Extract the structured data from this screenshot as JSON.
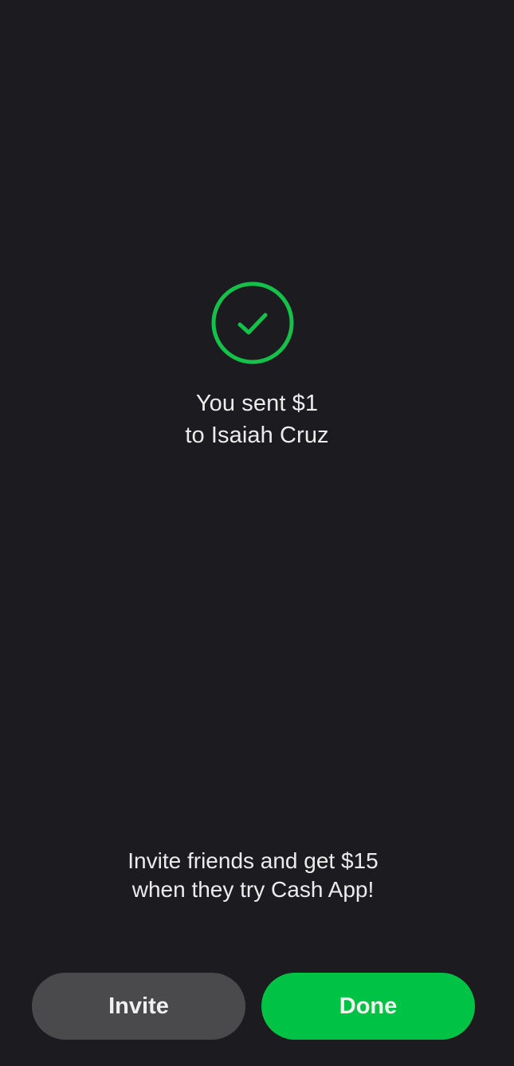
{
  "confirmation": {
    "line1": "You sent $1",
    "line2": "to Isaiah Cruz"
  },
  "icon": {
    "name": "check-circle-icon",
    "color": "#14c24a"
  },
  "promo": {
    "line1": "Invite friends and get $15",
    "line2": "when they try Cash App!"
  },
  "buttons": {
    "invite_label": "Invite",
    "done_label": "Done"
  },
  "colors": {
    "background": "#1c1b20",
    "accent": "#00c244",
    "secondary_button": "#4a4a4d"
  }
}
